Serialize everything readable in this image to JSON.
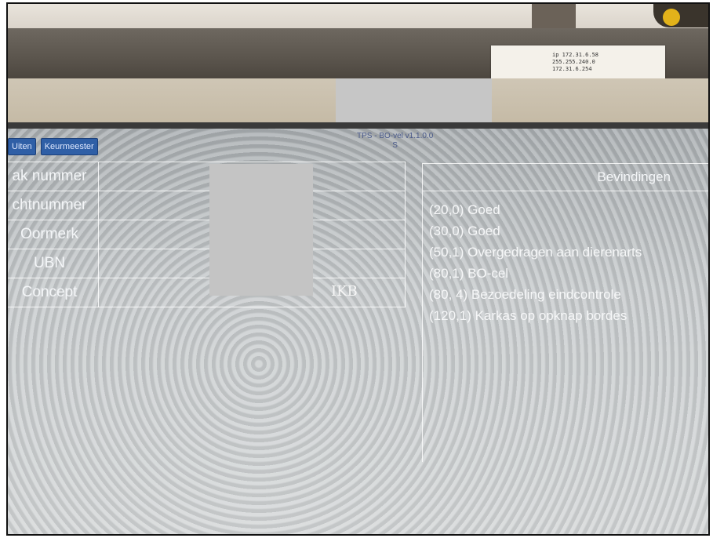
{
  "sticker": {
    "line1": "ip 172.31.6.58",
    "line2": "255.255.240.0",
    "line3": "172.31.6.254"
  },
  "toolbar": {
    "uiten_label": "Uiten",
    "keurmeester_label": "Keurmeester"
  },
  "app": {
    "version": "TPS - BO-vel v1.1.0.0",
    "version_sub": "S"
  },
  "info_rows": [
    {
      "label": "ak nummer",
      "value": ""
    },
    {
      "label": "chtnummer",
      "value": ""
    },
    {
      "label": "Oormerk",
      "value": ""
    },
    {
      "label": "UBN",
      "value": ""
    },
    {
      "label": "Concept",
      "value": "IKB"
    }
  ],
  "findings": {
    "title": "Bevindingen",
    "items": [
      "(20,0) Goed",
      "(30,0) Goed",
      "(50,1) Overgedragen aan dierenarts",
      "(80,1) BO-cel",
      "(80, 4) Bezoedeling eindcontrole",
      "(120,1) Karkas op opknap bordes"
    ]
  },
  "colors": {
    "button_bg": "#2f5fa6",
    "screen_bg": "#c7cbcd",
    "text": "#f4f6f8"
  }
}
